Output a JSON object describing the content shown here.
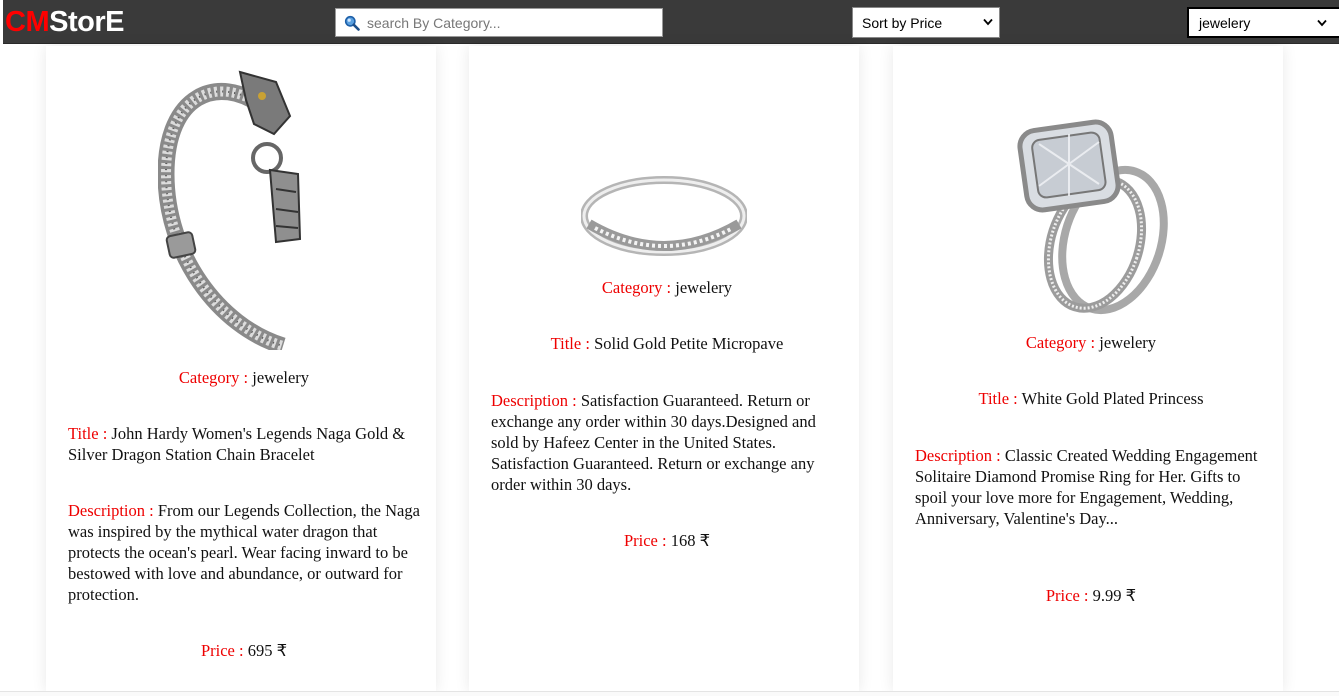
{
  "header": {
    "logo_prefix": "CM",
    "logo_suffix": "StorE",
    "search_placeholder": "search By Category...",
    "sort_selected": "Sort by Price",
    "category_selected": "jewelery"
  },
  "labels": {
    "category": "Category :",
    "title": "Title :",
    "description": "Description :",
    "price": "Price :"
  },
  "products": [
    {
      "category": "jewelery",
      "title": "John Hardy Women's Legends Naga Gold & Silver Dragon Station Chain Bracelet",
      "description": "From our Legends Collection, the Naga was inspired by the mythical water dragon that protects the ocean's pearl. Wear facing inward to be bestowed with love and abundance, or outward for protection.",
      "price": "695 ₹",
      "image": "silver-dragon-chain-bracelet"
    },
    {
      "category": "jewelery",
      "title": "Solid Gold Petite Micropave",
      "description": "Satisfaction Guaranteed. Return or exchange any order within 30 days.Designed and sold by Hafeez Center in the United States. Satisfaction Guaranteed. Return or exchange any order within 30 days.",
      "price": "168 ₹",
      "image": "thin-micropave-band-ring"
    },
    {
      "category": "jewelery",
      "title": "White Gold Plated Princess",
      "description": "Classic Created Wedding Engagement Solitaire Diamond Promise Ring for Her. Gifts to spoil your love more for Engagement, Wedding, Anniversary, Valentine's Day...",
      "price": "9.99 ₹",
      "image": "diamond-halo-engagement-ring-set"
    }
  ],
  "colors": {
    "navbar": "#3a3a3a",
    "logo_accent": "#ff0000",
    "label": "#ee0000"
  }
}
